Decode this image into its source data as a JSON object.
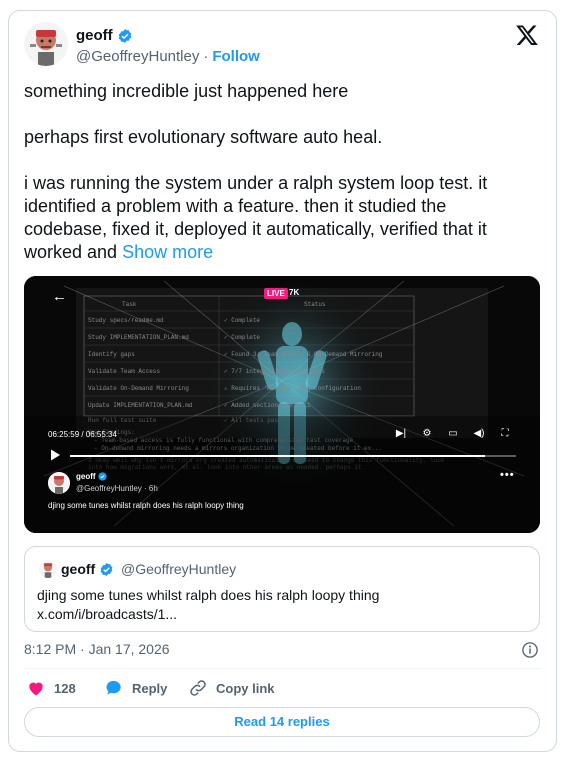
{
  "colors": {
    "accent": "#1d9bf0",
    "like": "#f91880",
    "text": "#0f1419",
    "muted": "#536471",
    "live": "#f91880"
  },
  "author": {
    "name": "geoff",
    "handle": "@GeoffreyHuntley",
    "separator": "·",
    "follow_label": "Follow",
    "verified_icon": "verified-badge-icon"
  },
  "brand_icon": "x-logo-icon",
  "tweet": {
    "paragraphs": [
      "something incredible just happened here",
      "perhaps first evolutionary software auto heal.",
      "i was running the system under a ralph system loop test. it identified a problem with a feature. then it studied the codebase, fixed it, deployed it automatically, verified that it worked and"
    ],
    "show_more_label": "Show more"
  },
  "video": {
    "live_label": "LIVE",
    "viewers": "7K",
    "timestamp": "06:25:59 / 06:55:34",
    "progress_fraction": 0.93,
    "author_name": "geoff",
    "author_handle": "@GeoffreyHuntley · 6h",
    "more_label": "•••",
    "caption": "djing some tunes whilst ralph does his ralph loopy thing",
    "screen_rows": [
      {
        "task": "Study specs/readme.md",
        "status": "✓ Complete"
      },
      {
        "task": "Study IMPLEMENTATION_PLAN.md",
        "status": "✓ Complete"
      },
      {
        "task": "Identify gaps",
        "status": "✓ Found 3: Team Access & On-Demand Mirroring"
      },
      {
        "task": "Validate Team Access",
        "status": "✓ 7/7 integration tests pass"
      },
      {
        "task": "Validate On-Demand Mirroring",
        "status": "⚠ Requires 'mirrors' org configuration"
      },
      {
        "task": "Update IMPLEMENTATION_PLAN.md",
        "status": "✓ Added sections 10 & 11"
      },
      {
        "task": "Run full test suite",
        "status": "✓ All tests pass"
      }
    ],
    "screen_header": {
      "task": "Task",
      "status": "Status"
    },
    "screen_findings": [
      "Key Findings:",
      "- Team-based access is fully functional with comprehensive test coverage",
      "- On-demand mirroring needs a mirrors organization to be created before it ex..."
    ],
    "screen_footer": [
      "3 okay well why isn't mirrors org created automatically, we need to change this functionality, look",
      "into how migrations work, et al. look into other areas as needed. perhaps it"
    ]
  },
  "quote": {
    "author_name": "geoff",
    "author_handle": "@GeoffreyHuntley",
    "text": "djing some tunes whilst ralph does his ralph loopy thing",
    "link": "x.com/i/broadcasts/1..."
  },
  "meta": {
    "date": "8:12 PM · Jan 17, 2026"
  },
  "actions": {
    "like_count": "128",
    "reply_label": "Reply",
    "copy_label": "Copy link"
  },
  "replies_button": "Read 14 replies"
}
